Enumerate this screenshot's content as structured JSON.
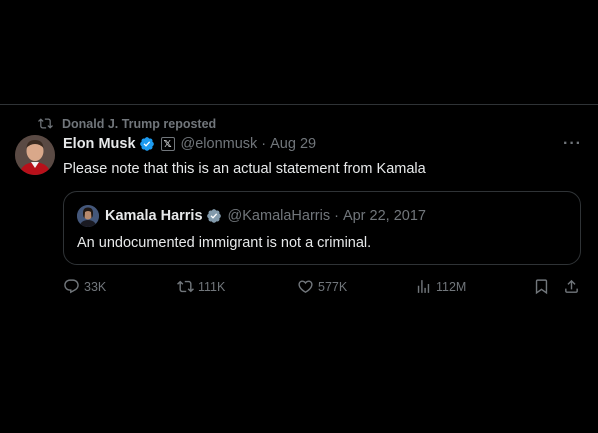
{
  "repost": {
    "label": "Donald J. Trump reposted",
    "icon": "repost-icon"
  },
  "tweet": {
    "author_name": "Elon Musk",
    "handle": "@elonmusk",
    "separator": "·",
    "date": "Aug 29",
    "text": "Please note that this is an actual statement from Kamala",
    "affiliate_badge": "𝕏",
    "verified_color": "#1d9bf0"
  },
  "quoted": {
    "author_name": "Kamala Harris",
    "handle": "@KamalaHarris",
    "separator": "·",
    "date": "Apr 22, 2017",
    "text": "An undocumented immigrant is not a criminal.",
    "verified_color": "#829aab"
  },
  "actions": {
    "replies": "33K",
    "reposts": "111K",
    "likes": "577K",
    "views": "112M"
  },
  "colors": {
    "background": "#000000",
    "text": "#e7e9ea",
    "muted": "#71767b",
    "border": "#2f3336"
  }
}
